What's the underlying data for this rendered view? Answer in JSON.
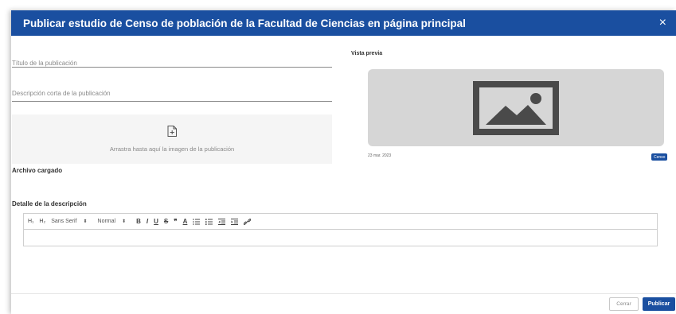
{
  "dialog": {
    "title": "Publicar estudio de Censo de población de la Facultad de Ciencias en página principal",
    "close_glyph": "×"
  },
  "form": {
    "title_field": {
      "placeholder": "Título de la publicación",
      "value": ""
    },
    "description_field": {
      "placeholder": "Descripción corta de la publicación",
      "value": ""
    },
    "dropzone": {
      "icon": "file-upload-icon",
      "text": "Arrastra hasta aquí la imagen de la publicación"
    },
    "uploaded_label": "Archivo cargado",
    "detail_label": "Detalle de la descripción"
  },
  "toolbar": {
    "h1": "H₁",
    "h2": "H₂",
    "font_select": "Sans Serif",
    "size_select": "Normal",
    "select_arrow": "⬍",
    "bold": "B",
    "italic": "I",
    "underline": "U",
    "strike": "S",
    "quote": "❞",
    "color": "A",
    "icons": [
      "ordered-list-icon",
      "bullet-list-icon",
      "indent-decrease-icon",
      "indent-increase-icon",
      "link-icon"
    ]
  },
  "preview": {
    "label": "Vista previa",
    "image_icon": "image-placeholder-icon",
    "date": "23 mar. 2023",
    "badge": "Censo"
  },
  "footer": {
    "cancel_label": "Cerrar",
    "publish_label": "Publicar"
  },
  "colors": {
    "primary": "#1a4fa0",
    "preview_bg": "#d6d6d6",
    "dropzone_bg": "#f5f5f5"
  }
}
